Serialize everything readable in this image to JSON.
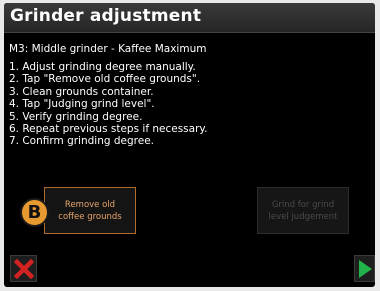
{
  "header": {
    "title": "Grinder adjustment"
  },
  "subtitle": "M3: Middle grinder  - Kaffee Maximum",
  "steps": [
    "1. Adjust grinding degree manually.",
    "2. Tap \"Remove old coffee grounds\".",
    "3. Clean grounds container.",
    "4. Tap \"Judging grind level\".",
    "5. Verify grinding degree.",
    "6. Repeat previous steps if necessary.",
    "7. Confirm grinding degree."
  ],
  "buttons": {
    "remove_label": "Remove old coffee grounds",
    "grind_label": "Grind for grind level judgement"
  },
  "badge": {
    "label": "B"
  },
  "icons": {
    "cancel": "x-icon",
    "confirm": "play-arrow-icon"
  },
  "colors": {
    "accent": "#e79a30",
    "cancel_red": "#d32222",
    "confirm_green": "#22b34a"
  }
}
